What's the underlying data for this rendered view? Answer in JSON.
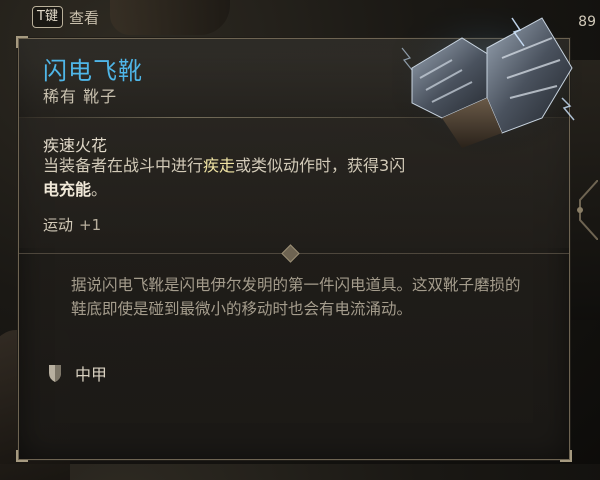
{
  "hint": {
    "key": "T键",
    "label": "查看"
  },
  "item": {
    "name": "闪电飞靴",
    "subtitle": "稀有 靴子",
    "effect_title": "疾速火花",
    "effect_desc_parts": [
      "当装备者在战斗中进行",
      "疾走",
      "或类似动作时，获得",
      "3",
      "闪",
      "电充能",
      "。"
    ],
    "bonus_label": "运动",
    "bonus_value": "+1",
    "lore": "据说闪电飞靴是闪电伊尔发明的第一件闪电道具。这双靴子磨损的鞋底即使是碰到最微小的移动时也会有电流涌动。",
    "armor_type": "中甲"
  },
  "corner_number": "89",
  "colors": {
    "name": "#4fb6e8",
    "keyword": "#efe3a4",
    "panel_border": "#6e6452"
  },
  "icons": {
    "armor": "shield-icon",
    "item": "boots-icon"
  }
}
